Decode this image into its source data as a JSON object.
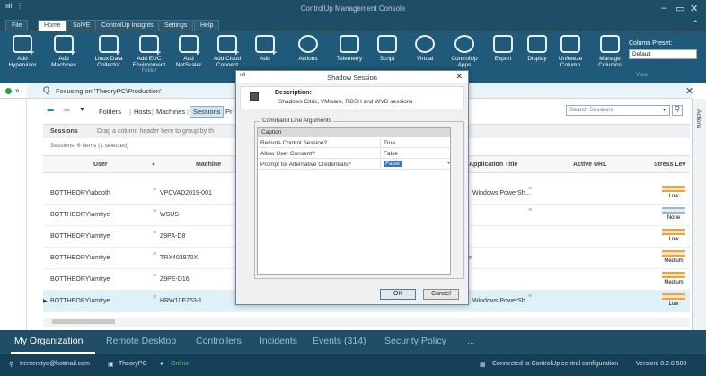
{
  "window": {
    "title": "ControlUp Management Console",
    "logo": "ııll",
    "minimize": "–",
    "restore": "▭",
    "close": "✕"
  },
  "menu": {
    "tabs": [
      "File",
      "Home",
      "SolVE",
      "ControlUp Insights",
      "Settings",
      "Help"
    ],
    "active": "Home",
    "collapse": "⌃"
  },
  "ribbon": {
    "buttons": [
      {
        "label": "Add\nHypervisor",
        "icon": "hypervisor-icon"
      },
      {
        "label": "Add\nMachines",
        "icon": "machines-icon"
      },
      {
        "label": "Linux Data\nCollector",
        "icon": "linux-icon"
      },
      {
        "label": "Add EUC\nEnvironment",
        "icon": "euc-icon"
      },
      {
        "label": "Add\nNetScaler",
        "icon": "netscaler-icon"
      },
      {
        "label": "Add Cloud\nConnect",
        "icon": "cloud-icon"
      },
      {
        "label": "Add",
        "icon": "add-icon"
      },
      {
        "label": "Actions",
        "icon": "gear-icon"
      },
      {
        "label": "Telemetry",
        "icon": "telemetry-icon"
      },
      {
        "label": "Script",
        "icon": "script-icon"
      },
      {
        "label": "Virtual",
        "icon": "virtual-icon"
      },
      {
        "label": "ControlUp\nApps",
        "icon": "apps-icon"
      },
      {
        "label": "Export",
        "icon": "export-icon"
      },
      {
        "label": "Display",
        "icon": "display-icon"
      },
      {
        "label": "Unfreeze\nColumn",
        "icon": "unfreeze-icon"
      },
      {
        "label": "Manage\nColumns",
        "icon": "manage-columns-icon"
      }
    ],
    "folder_label": "Folder",
    "column_preset_label": "Column Preset:",
    "column_preset_value": "Default",
    "view_label": "View"
  },
  "focus": {
    "text": "Focusing on 'TheoryPC\\Production'",
    "search_glyph": "Q"
  },
  "nav": {
    "crumbs": [
      "Folders",
      "Hosts",
      "Machines",
      "Sessions",
      "Pr"
    ],
    "active": "Sessions",
    "search_placeholder": "Search Sessions",
    "search_glyph": "Q",
    "dropdown_glyph": "▾"
  },
  "actions_label": "Actions",
  "grid": {
    "group_label": "Sessions",
    "group_hint": "Drag a column header here to group by th",
    "count": "Sessions: 6 Items (1 selected)",
    "columns": [
      "User",
      "Machine",
      "Application Title",
      "Active URL",
      "Stress Lev"
    ],
    "rows": [
      {
        "user": "BOTTHEORY\\abooth",
        "machine": "VPCVAD2019-001",
        "app": "Windows PowerSh...",
        "stress": "Low"
      },
      {
        "user": "BOTTHEORY\\amttye",
        "machine": "WSUS",
        "app": "",
        "stress": "None"
      },
      {
        "user": "BOTTHEORY\\amttye",
        "machine": "Z9PA-D8",
        "app": "",
        "stress": "Low"
      },
      {
        "user": "BOTTHEORY\\amttye",
        "machine": "TRX403970X",
        "app": "n",
        "stress": "Medium"
      },
      {
        "user": "BOTTHEORY\\amttye",
        "machine": "Z9PE-D16",
        "app": "",
        "stress": "Medium"
      },
      {
        "user": "BOTTHEORY\\amttye",
        "machine": "HRW10E263-1",
        "app": "Windows PowerSh...",
        "stress": "Low"
      }
    ]
  },
  "dialog": {
    "title": "Shadow Session",
    "close": "✕",
    "description_heading": "Description:",
    "description_text": "Shadows Citrix, VMware, RDSH and WVD sessions",
    "group_label": "Command Line Arguments",
    "table_header": "Caption",
    "args": [
      {
        "key": "Remote Control Session?",
        "value": "True"
      },
      {
        "key": "Allow User Consent?",
        "value": "False"
      },
      {
        "key": "Prompt for Alternative Credentials?",
        "value": "False"
      }
    ],
    "ok_label": "OK",
    "cancel_label": "Cancel"
  },
  "bottom_tabs": [
    "My Organization",
    "Remote Desktop",
    "Controllers",
    "Incidents",
    "Events (314)",
    "Security Policy",
    "..."
  ],
  "status": {
    "user": "trententtye@hotmail.com",
    "machine": "TheoryPC",
    "state": "Online",
    "connection": "Connected to ControlUp central configuration",
    "version": "Version: 8.2.0.500"
  },
  "colors": {
    "accent": "#1f4e66",
    "selection": "#dff1f8",
    "online": "#4cc26a",
    "severity_low": "#f0a33c"
  }
}
